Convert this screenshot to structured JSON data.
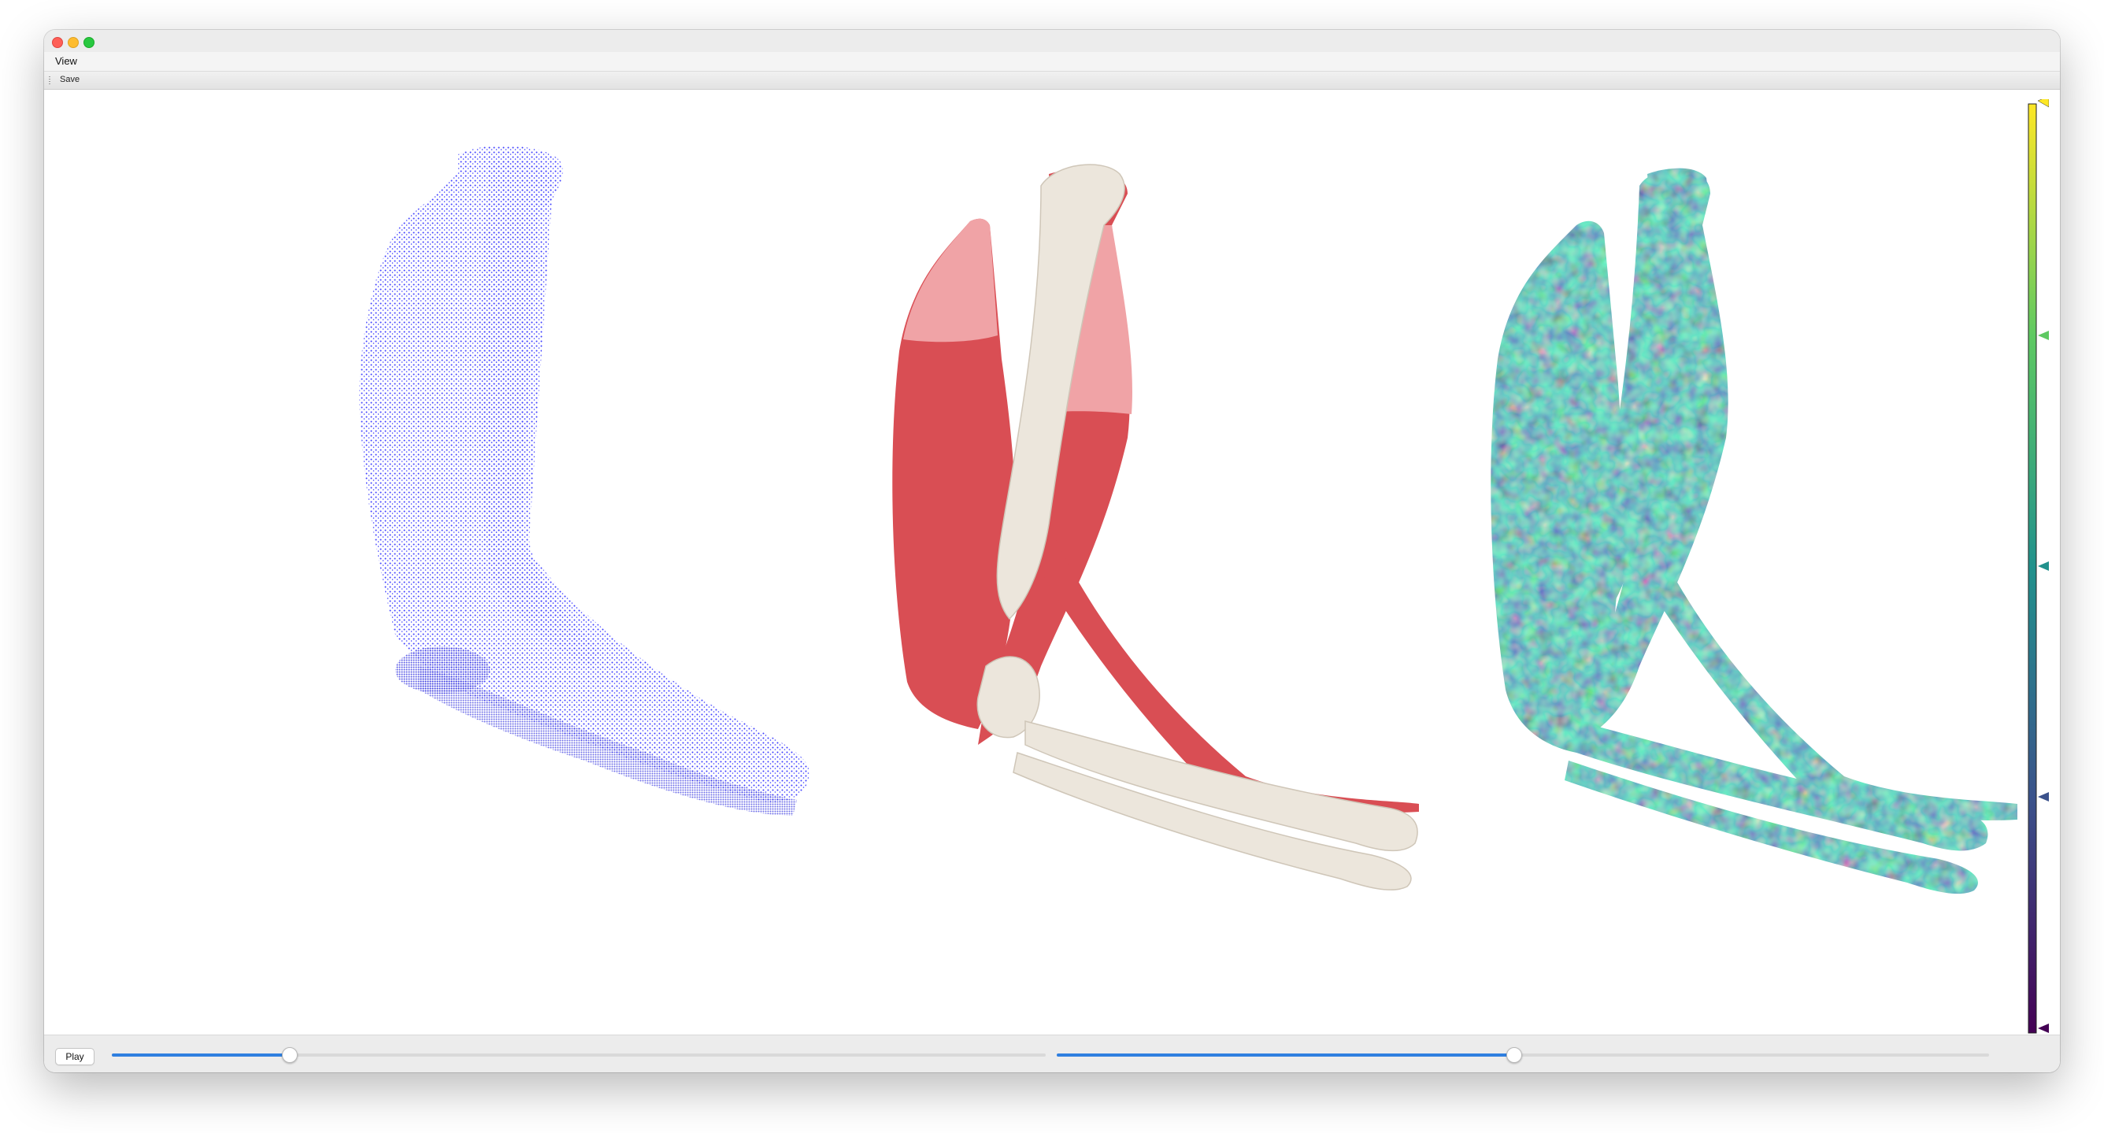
{
  "window": {
    "menu": {
      "view_label": "View"
    },
    "toolbar": {
      "save_label": "Save"
    }
  },
  "viewport": {
    "panels": [
      {
        "name": "point-cloud",
        "color": "#1a1aff"
      },
      {
        "name": "muscle-bone-mesh",
        "muscle_color": "#d94e54",
        "bone_color": "#ece6dc"
      },
      {
        "name": "scalar-field-mesh",
        "colormap": "viridis"
      }
    ],
    "colorbar": {
      "colormap": "viridis",
      "colors": [
        "#fde725",
        "#5ec962",
        "#21918c",
        "#3b528b",
        "#440154"
      ]
    }
  },
  "controls": {
    "play_label": "Play",
    "sliders": [
      {
        "value": 0.19
      },
      {
        "value": 0.49
      }
    ]
  }
}
